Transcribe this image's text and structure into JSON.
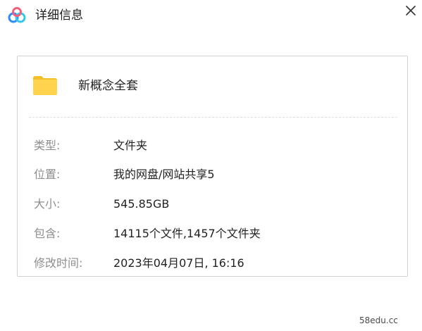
{
  "window": {
    "title": "详细信息"
  },
  "item": {
    "name": "新概念全套"
  },
  "details": [
    {
      "label": "类型:",
      "value": "文件夹"
    },
    {
      "label": "位置:",
      "value": "我的网盘/网站共享5"
    },
    {
      "label": "大小:",
      "value": "545.85GB"
    },
    {
      "label": "包含:",
      "value": "14115个文件,1457个文件夹"
    },
    {
      "label": "修改时间:",
      "value": "2023年04月07日, 16:16"
    }
  ],
  "watermark": "58edu.cc",
  "colors": {
    "logo_blue": "#2f8cf5",
    "logo_cyan": "#35c7e8",
    "logo_pink": "#f2607a",
    "folder_yellow": "#ffd34d",
    "label_gray": "#8e8e8e",
    "border": "#d2d2d2"
  }
}
